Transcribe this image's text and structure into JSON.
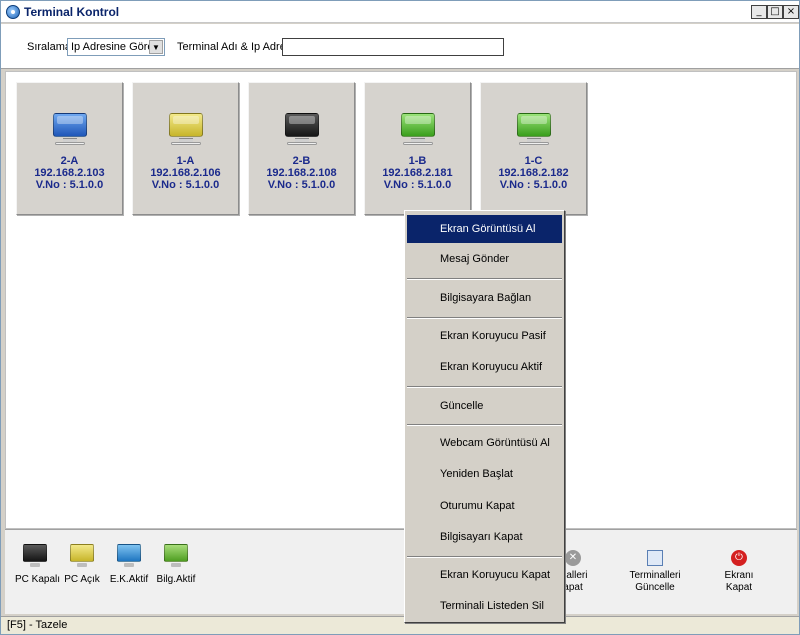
{
  "window": {
    "title": "Terminal Kontrol",
    "minimize_glyph": "_",
    "maximize_glyph": "□",
    "close_glyph": "×"
  },
  "filter": {
    "sort_label": "Sıralama",
    "sort_value": "Ip Adresine Göre",
    "search_label": "Terminal Adı & Ip Adresi",
    "search_value": ""
  },
  "terminals": [
    {
      "name": "2-A",
      "ip": "192.168.2.103",
      "version": "V.No : 5.1.0.0",
      "status": "closed-blue",
      "color": "#2e6fd6"
    },
    {
      "name": "1-A",
      "ip": "192.168.2.106",
      "version": "V.No : 5.1.0.0",
      "status": "yellow",
      "color": "#d9c93a"
    },
    {
      "name": "2-B",
      "ip": "192.168.2.108",
      "version": "V.No : 5.1.0.0",
      "status": "black",
      "color": "#2b2b2b"
    },
    {
      "name": "1-B",
      "ip": "192.168.2.181",
      "version": "V.No : 5.1.0.0",
      "status": "green",
      "color": "#4cbb2a"
    },
    {
      "name": "1-C",
      "ip": "192.168.2.182",
      "version": "V.No : 5.1.0.0",
      "status": "green",
      "color": "#4cbb2a"
    }
  ],
  "legend": [
    {
      "label": "PC Kapalı",
      "color": "#2b2b2b"
    },
    {
      "label": "PC Açık",
      "color": "#d9c93a"
    },
    {
      "label": "E.K.Aktif",
      "color": "#2e8fd6"
    },
    {
      "label": "Bilg.Aktif",
      "color": "#6fbb3a"
    }
  ],
  "toolbar": {
    "close_terminals_label_1": "inalleri",
    "close_terminals_label_2": "apat",
    "update_terminals_label_1": "Terminalleri",
    "update_terminals_label_2": "Güncelle",
    "close_screen_label_1": "Ekranı",
    "close_screen_label_2": "Kapat"
  },
  "status_bar": {
    "text": "[F5] - Tazele"
  },
  "context_menu": {
    "items": [
      "Ekran Görüntüsü Al",
      "Mesaj Gönder",
      "Bilgisayara Bağlan",
      "Ekran Koruyucu Pasif",
      "Ekran Koruyucu Aktif",
      "Güncelle",
      "Webcam  Görüntüsü Al",
      "Yeniden Başlat",
      "Oturumu Kapat",
      "Bilgisayarı Kapat",
      "Ekran Koruyucu Kapat",
      "Terminali Listeden Sil"
    ],
    "active_item": "Ekran Görüntüsü Al"
  }
}
